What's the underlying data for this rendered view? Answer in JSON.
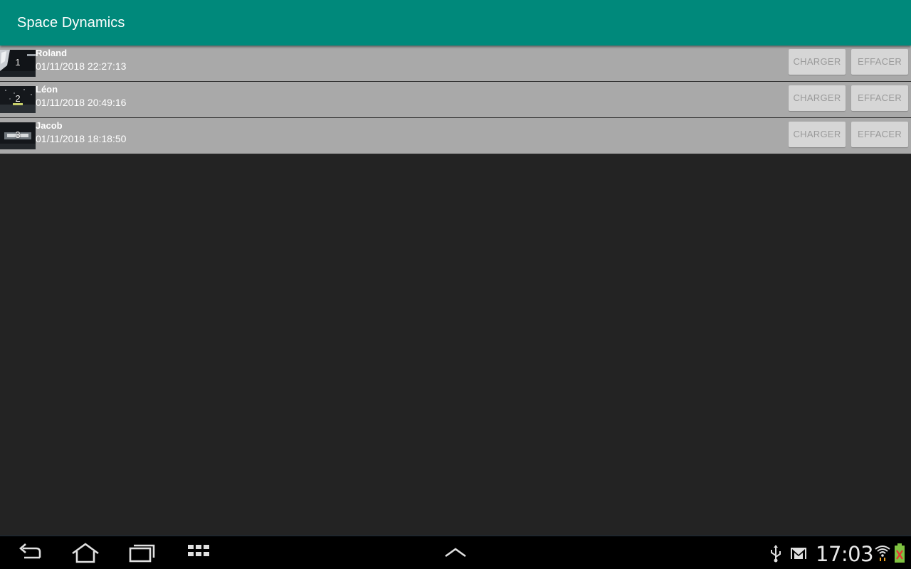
{
  "app_bar": {
    "title": "Space Dynamics"
  },
  "saves": [
    {
      "index": "1",
      "name": "Roland",
      "date": "01/11/2018 22:27:13",
      "load_label": "CHARGER",
      "delete_label": "EFFACER"
    },
    {
      "index": "2",
      "name": "Léon",
      "date": "01/11/2018 20:49:16",
      "load_label": "CHARGER",
      "delete_label": "EFFACER"
    },
    {
      "index": "3",
      "name": "Jacob",
      "date": "01/11/2018 18:18:50",
      "load_label": "CHARGER",
      "delete_label": "EFFACER"
    }
  ],
  "status_bar": {
    "time": "17:03",
    "icons": [
      "usb-icon",
      "gmail-icon",
      "wifi-icon",
      "battery-icon"
    ]
  },
  "nav_bar": {
    "icons": [
      "back-icon",
      "home-icon",
      "recent-apps-icon",
      "app-drawer-icon",
      "expand-up-icon"
    ]
  },
  "colors": {
    "app_bar": "#00897b",
    "row_background": "#a9a9a9",
    "page_background": "#232323",
    "button_background": "#d6d6d6",
    "button_text": "#9a9a9a",
    "nav_background": "#000000"
  }
}
